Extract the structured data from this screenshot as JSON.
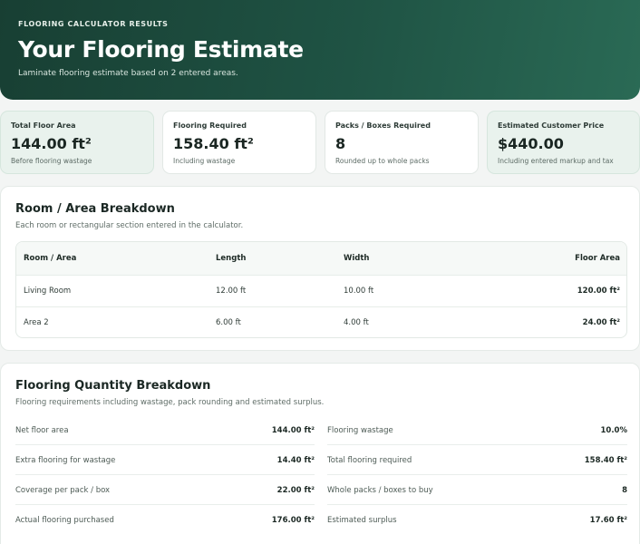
{
  "hero": {
    "kicker": "FLOORING CALCULATOR RESULTS",
    "title": "Your Flooring Estimate",
    "subtitle": "Laminate flooring estimate based on 2 entered areas."
  },
  "summary_cards": [
    {
      "label": "Total Floor Area",
      "value": "144.00 ft²",
      "note": "Before flooring wastage"
    },
    {
      "label": "Flooring Required",
      "value": "158.40 ft²",
      "note": "Including wastage"
    },
    {
      "label": "Packs / Boxes Required",
      "value": "8",
      "note": "Rounded up to whole packs"
    },
    {
      "label": "Estimated Customer Price",
      "value": "$440.00",
      "note": "Including entered markup and tax"
    }
  ],
  "room_breakdown": {
    "title": "Room / Area Breakdown",
    "subtitle": "Each room or rectangular section entered in the calculator.",
    "columns": [
      "Room / Area",
      "Length",
      "Width",
      "Floor Area"
    ],
    "rows": [
      [
        "Living Room",
        "12.00 ft",
        "10.00 ft",
        "120.00 ft²"
      ],
      [
        "Area 2",
        "6.00 ft",
        "4.00 ft",
        "24.00 ft²"
      ]
    ]
  },
  "quantity_breakdown": {
    "title": "Flooring Quantity Breakdown",
    "subtitle": "Flooring requirements including wastage, pack rounding and estimated surplus.",
    "left": [
      {
        "label": "Net floor area",
        "value": "144.00 ft²"
      },
      {
        "label": "Extra flooring for wastage",
        "value": "14.40 ft²"
      },
      {
        "label": "Coverage per pack / box",
        "value": "22.00 ft²"
      },
      {
        "label": "Actual flooring purchased",
        "value": "176.00 ft²"
      }
    ],
    "right": [
      {
        "label": "Flooring wastage",
        "value": "10.0%"
      },
      {
        "label": "Total flooring required",
        "value": "158.40 ft²"
      },
      {
        "label": "Whole packs / boxes to buy",
        "value": "8"
      },
      {
        "label": "Estimated surplus",
        "value": "17.60 ft²"
      }
    ]
  }
}
